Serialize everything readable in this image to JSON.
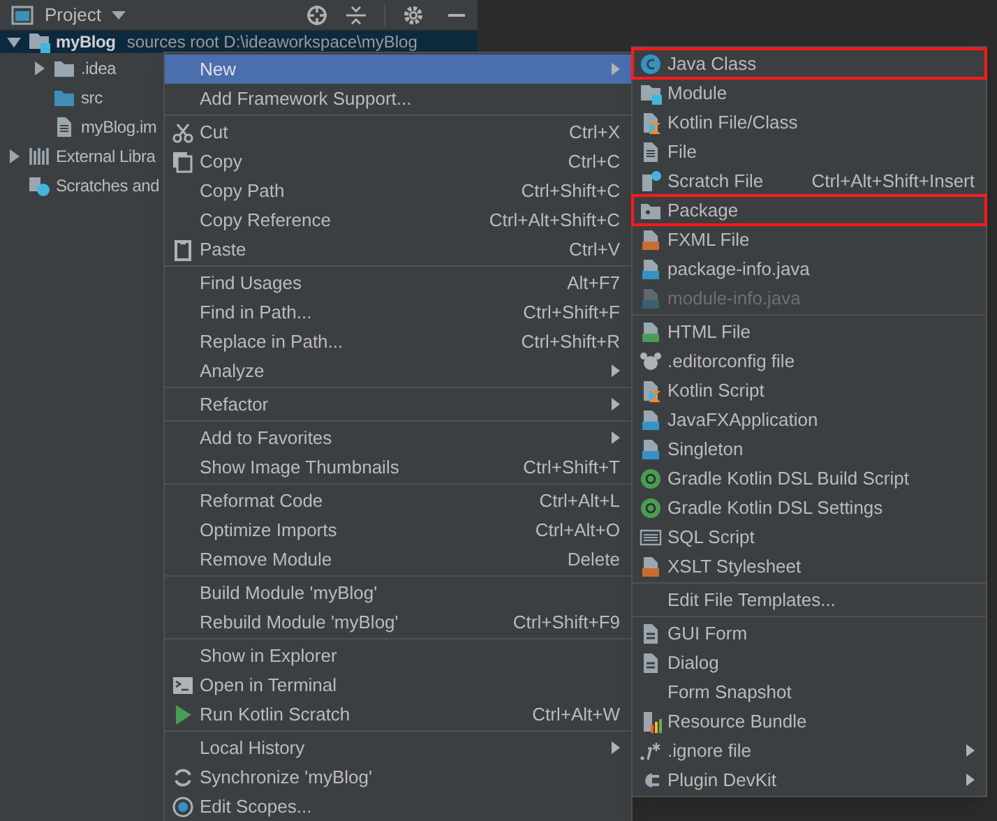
{
  "panel": {
    "title": "Project"
  },
  "tree": [
    {
      "name": "myBlog",
      "note": "sources root  D:\\ideaworkspace\\myBlog",
      "kind": "module",
      "selected": true,
      "expanded": true,
      "children": [
        {
          "name": ".idea",
          "kind": "folder",
          "expanded": false
        },
        {
          "name": "src",
          "kind": "source-folder"
        },
        {
          "name": "myBlog.im",
          "kind": "file"
        }
      ]
    },
    {
      "name": "External Libra",
      "kind": "libraries",
      "expanded": false
    },
    {
      "name": "Scratches and",
      "kind": "scratches"
    }
  ],
  "context_menu": {
    "groups": [
      [
        {
          "label": "New",
          "submenu": true,
          "selected": true
        },
        {
          "label": "Add Framework Support...",
          "selected": false
        }
      ],
      [
        {
          "label": "Cut",
          "shortcut": "Ctrl+X",
          "kind": "cut",
          "selected": false
        },
        {
          "label": "Copy",
          "shortcut": "Ctrl+C",
          "kind": "copy",
          "selected": false
        },
        {
          "label": "Copy Path",
          "shortcut": "Ctrl+Shift+C",
          "selected": false
        },
        {
          "label": "Copy Reference",
          "shortcut": "Ctrl+Alt+Shift+C",
          "selected": false
        },
        {
          "label": "Paste",
          "shortcut": "Ctrl+V",
          "kind": "paste",
          "selected": false
        }
      ],
      [
        {
          "label": "Find Usages",
          "shortcut": "Alt+F7",
          "selected": false
        },
        {
          "label": "Find in Path...",
          "shortcut": "Ctrl+Shift+F",
          "selected": false
        },
        {
          "label": "Replace in Path...",
          "shortcut": "Ctrl+Shift+R",
          "selected": false
        },
        {
          "label": "Analyze",
          "submenu": true,
          "selected": false
        }
      ],
      [
        {
          "label": "Refactor",
          "submenu": true,
          "selected": false
        }
      ],
      [
        {
          "label": "Add to Favorites",
          "submenu": true,
          "selected": false
        },
        {
          "label": "Show Image Thumbnails",
          "shortcut": "Ctrl+Shift+T",
          "selected": false
        }
      ],
      [
        {
          "label": "Reformat Code",
          "shortcut": "Ctrl+Alt+L",
          "selected": false
        },
        {
          "label": "Optimize Imports",
          "shortcut": "Ctrl+Alt+O",
          "selected": false
        },
        {
          "label": "Remove Module",
          "shortcut": "Delete",
          "selected": false
        }
      ],
      [
        {
          "label": "Build Module 'myBlog'",
          "selected": false
        },
        {
          "label": "Rebuild Module 'myBlog'",
          "shortcut": "Ctrl+Shift+F9",
          "selected": false
        }
      ],
      [
        {
          "label": "Show in Explorer",
          "selected": false
        },
        {
          "label": "Open in Terminal",
          "kind": "terminal",
          "selected": false
        },
        {
          "label": "Run Kotlin Scratch",
          "shortcut": "Ctrl+Alt+W",
          "kind": "run",
          "selected": false
        }
      ],
      [
        {
          "label": "Local History",
          "submenu": true,
          "selected": false
        },
        {
          "label": "Synchronize 'myBlog'",
          "kind": "sync",
          "selected": false
        },
        {
          "label": "Edit Scopes...",
          "kind": "scope",
          "selected": false
        }
      ]
    ]
  },
  "new_submenu": {
    "groups": [
      [
        {
          "label": "Java Class",
          "kind": "class",
          "highlighted": true,
          "disabled": false
        },
        {
          "label": "Module",
          "kind": "module",
          "highlighted": false,
          "disabled": false
        },
        {
          "label": "Kotlin File/Class",
          "kind": "kotlin",
          "highlighted": false,
          "disabled": false
        },
        {
          "label": "File",
          "kind": "file",
          "highlighted": false,
          "disabled": false
        },
        {
          "label": "Scratch File",
          "shortcut": "Ctrl+Alt+Shift+Insert",
          "kind": "scratch",
          "highlighted": false,
          "disabled": false
        },
        {
          "label": "Package",
          "kind": "package",
          "highlighted": true,
          "disabled": false
        },
        {
          "label": "FXML File",
          "kind": "xml",
          "highlighted": false,
          "disabled": false
        },
        {
          "label": "package-info.java",
          "kind": "java-file",
          "highlighted": false,
          "disabled": false
        },
        {
          "label": "module-info.java",
          "kind": "java-file",
          "highlighted": false,
          "disabled": true
        }
      ],
      [
        {
          "label": "HTML File",
          "kind": "html",
          "highlighted": false,
          "disabled": false
        },
        {
          "label": ".editorconfig file",
          "kind": "editorconfig",
          "highlighted": false,
          "disabled": false
        },
        {
          "label": "Kotlin Script",
          "kind": "kotlin",
          "highlighted": false,
          "disabled": false
        },
        {
          "label": "JavaFXApplication",
          "kind": "java-file",
          "highlighted": false,
          "disabled": false
        },
        {
          "label": "Singleton",
          "kind": "java-file",
          "highlighted": false,
          "disabled": false
        },
        {
          "label": "Gradle Kotlin DSL Build Script",
          "kind": "gradle",
          "highlighted": false,
          "disabled": false
        },
        {
          "label": "Gradle Kotlin DSL Settings",
          "kind": "gradle",
          "highlighted": false,
          "disabled": false
        },
        {
          "label": "SQL Script",
          "kind": "sql",
          "highlighted": false,
          "disabled": false
        },
        {
          "label": "XSLT Stylesheet",
          "kind": "xml",
          "highlighted": false,
          "disabled": false
        }
      ],
      [
        {
          "label": "Edit File Templates...",
          "highlighted": false,
          "disabled": false
        }
      ],
      [
        {
          "label": "GUI Form",
          "kind": "form",
          "highlighted": false,
          "disabled": false
        },
        {
          "label": "Dialog",
          "kind": "form",
          "highlighted": false,
          "disabled": false
        },
        {
          "label": "Form Snapshot",
          "highlighted": false,
          "disabled": false
        },
        {
          "label": "Resource Bundle",
          "kind": "bundle",
          "highlighted": false,
          "disabled": false
        },
        {
          "label": ".ignore file",
          "kind": "ignore",
          "submenu": true,
          "highlighted": false,
          "disabled": false
        },
        {
          "label": "Plugin DevKit",
          "kind": "plugin",
          "submenu": true,
          "highlighted": false,
          "disabled": false
        }
      ]
    ]
  }
}
